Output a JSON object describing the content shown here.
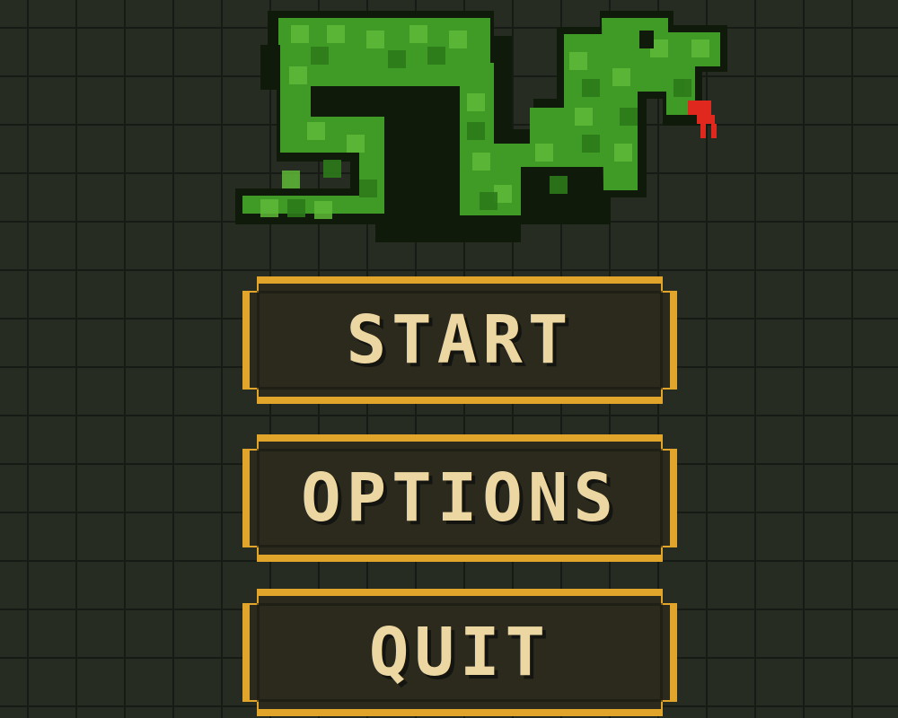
{
  "menu": {
    "start_label": "START",
    "options_label": "OPTIONS",
    "quit_label": "QUIT"
  },
  "colors": {
    "background": "#262c21",
    "grid_line": "#171b15",
    "snake_green": "#3f9b25",
    "snake_light": "#5fb938",
    "snake_dark": "#2d7a1b",
    "snake_outline": "#0f1a0b",
    "tongue": "#e0281e",
    "button_border": "#e1a52c",
    "button_fill": "#2b2a1c",
    "button_text": "#ecd7a2"
  },
  "icons": {
    "logo": "pixel-snake-logo-icon"
  }
}
